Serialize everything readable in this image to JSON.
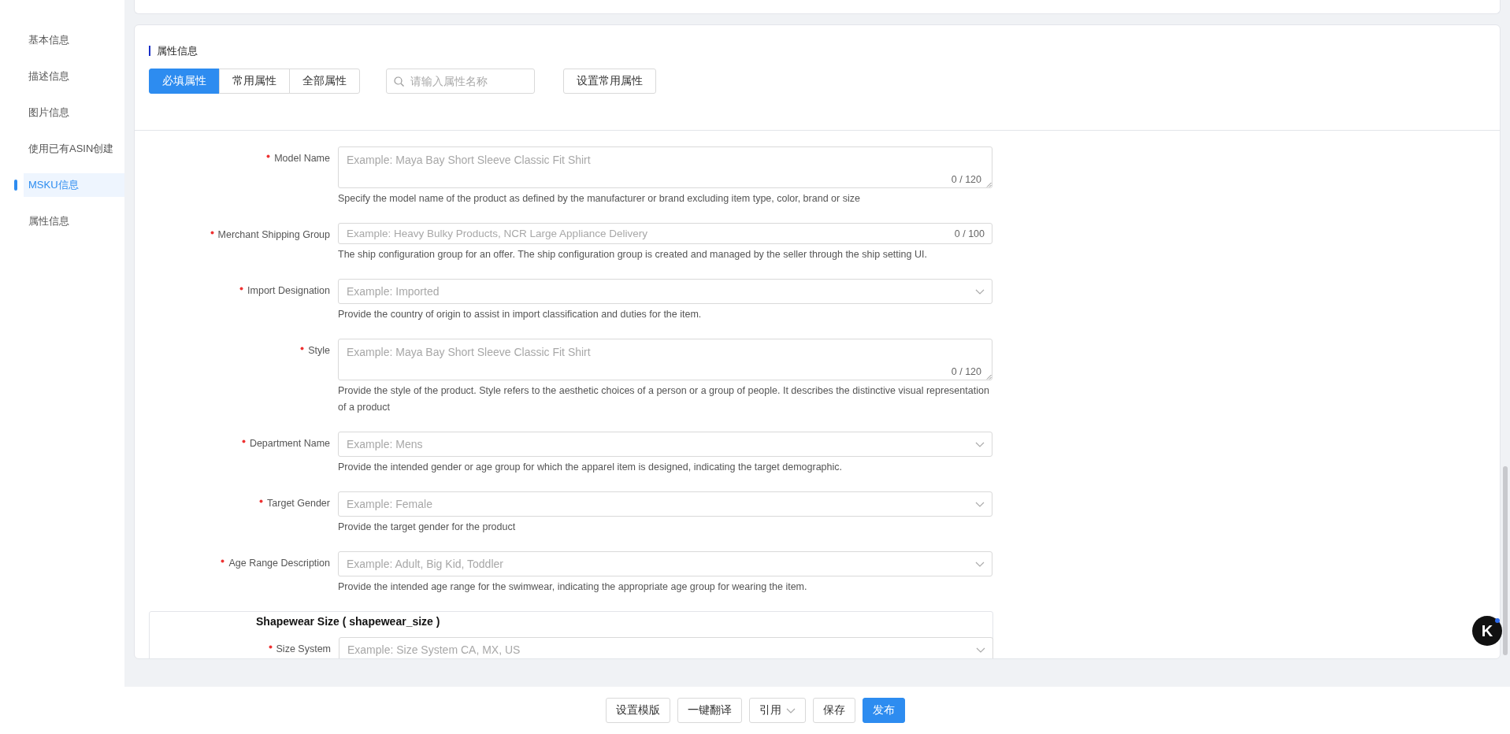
{
  "sidebar": {
    "items": [
      {
        "label": "基本信息",
        "selected": false
      },
      {
        "label": "描述信息",
        "selected": false
      },
      {
        "label": "图片信息",
        "selected": false
      },
      {
        "label": "使用已有ASIN创建",
        "selected": false
      },
      {
        "label": "MSKU信息",
        "selected": true
      },
      {
        "label": "属性信息",
        "selected": false
      }
    ]
  },
  "section": {
    "title": "属性信息",
    "tabs": [
      {
        "label": "必填属性",
        "selected": true
      },
      {
        "label": "常用属性",
        "selected": false
      },
      {
        "label": "全部属性",
        "selected": false
      }
    ],
    "search": {
      "placeholder": "请输入属性名称"
    },
    "settings_button": "设置常用属性"
  },
  "fields": [
    {
      "kind": "textarea",
      "label": "Model Name",
      "required": true,
      "placeholder": "Example: Maya Bay Short Sleeve Classic Fit Shirt",
      "counter": "0 / 120",
      "help": "Specify the model name of the product as defined by the manufacturer or brand excluding item type, color, brand or size"
    },
    {
      "kind": "input",
      "label": "Merchant Shipping Group",
      "required": true,
      "placeholder": "Example: Heavy Bulky Products, NCR Large Appliance Delivery",
      "counter": "0 / 100",
      "help": "The ship configuration group for an offer. The ship configuration group is created and managed by the seller through the ship setting UI."
    },
    {
      "kind": "select",
      "label": "Import Designation",
      "required": true,
      "placeholder": "Example: Imported",
      "help": "Provide the country of origin to assist in import classification and duties for the item."
    },
    {
      "kind": "textarea",
      "label": "Style",
      "required": true,
      "placeholder": "Example: Maya Bay Short Sleeve Classic Fit Shirt",
      "counter": "0 / 120",
      "help": "Provide the style of the product. Style refers to the aesthetic choices of a person or a group of people. It describes the distinctive visual representation of a product"
    },
    {
      "kind": "select",
      "label": "Department Name",
      "required": true,
      "placeholder": "Example: Mens",
      "help": "Provide the intended gender or age group for which the apparel item is designed, indicating the target demographic."
    },
    {
      "kind": "select",
      "label": "Target Gender",
      "required": true,
      "placeholder": "Example: Female",
      "help": "Provide the target gender for the product"
    },
    {
      "kind": "select",
      "label": "Age Range Description",
      "required": true,
      "placeholder": "Example: Adult, Big Kid, Toddler",
      "help": "Provide the intended age range for the swimwear, indicating the appropriate age group for wearing the item."
    }
  ],
  "group": {
    "title": "Shapewear Size ( shapewear_size )",
    "fields": [
      {
        "kind": "select",
        "label": "Size System",
        "required": true,
        "placeholder": "Example: Size System CA, MX, US"
      }
    ]
  },
  "footer_buttons": [
    {
      "label": "设置模版",
      "kind": "default"
    },
    {
      "label": "一键翻译",
      "kind": "default"
    },
    {
      "label": "引用",
      "kind": "dropdown"
    },
    {
      "label": "保存",
      "kind": "default"
    },
    {
      "label": "发布",
      "kind": "primary"
    }
  ],
  "floating_button": {
    "label": "K"
  }
}
